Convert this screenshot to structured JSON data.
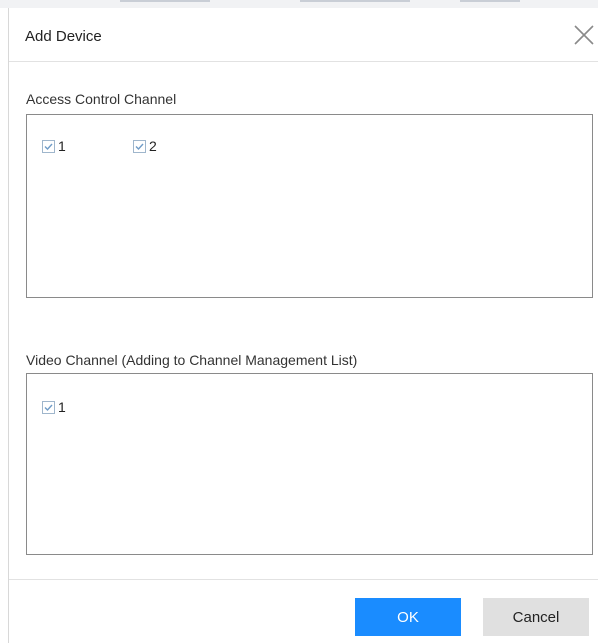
{
  "dialog": {
    "title": "Add Device",
    "close_icon": "close-icon"
  },
  "access_control": {
    "label": "Access Control Channel",
    "channels": [
      {
        "label": "1",
        "checked": true
      },
      {
        "label": "2",
        "checked": true
      }
    ]
  },
  "video": {
    "label": "Video Channel (Adding to Channel Management List)",
    "channels": [
      {
        "label": "1",
        "checked": true
      }
    ]
  },
  "footer": {
    "ok_label": "OK",
    "cancel_label": "Cancel"
  },
  "colors": {
    "primary": "#1a8cff",
    "checkbox_border": "#9fb6cc",
    "check_mark": "#6f9bc7",
    "box_border": "#8a8a8a"
  }
}
